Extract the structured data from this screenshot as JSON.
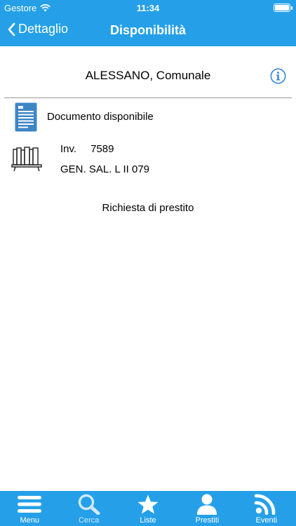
{
  "status_bar": {
    "carrier": "Gestore",
    "time": "11:34",
    "battery_level": 1.0
  },
  "navbar": {
    "back_label": "Dettaglio",
    "title": "Disponibilità"
  },
  "library": {
    "name": "ALESSANO, Comunale"
  },
  "document": {
    "status_text": "Documento disponibile"
  },
  "copy": {
    "inv_label": "Inv.",
    "inv_value": "7589",
    "collocation": "GEN. SAL. L II 079"
  },
  "actions": {
    "loan_request": "Richiesta di prestito"
  },
  "tabbar": {
    "items": [
      {
        "label": "Menu",
        "icon": "menu-icon",
        "active": true
      },
      {
        "label": "Cerca",
        "icon": "search-icon",
        "active": false
      },
      {
        "label": "Liste",
        "icon": "star-icon",
        "active": true
      },
      {
        "label": "Prestiti",
        "icon": "user-icon",
        "active": true
      },
      {
        "label": "Eventi",
        "icon": "rss-icon",
        "active": true
      }
    ]
  },
  "colors": {
    "accent": "#25a0e8",
    "info_icon": "#2a7fd4",
    "doc_icon": "#3d86c6"
  }
}
